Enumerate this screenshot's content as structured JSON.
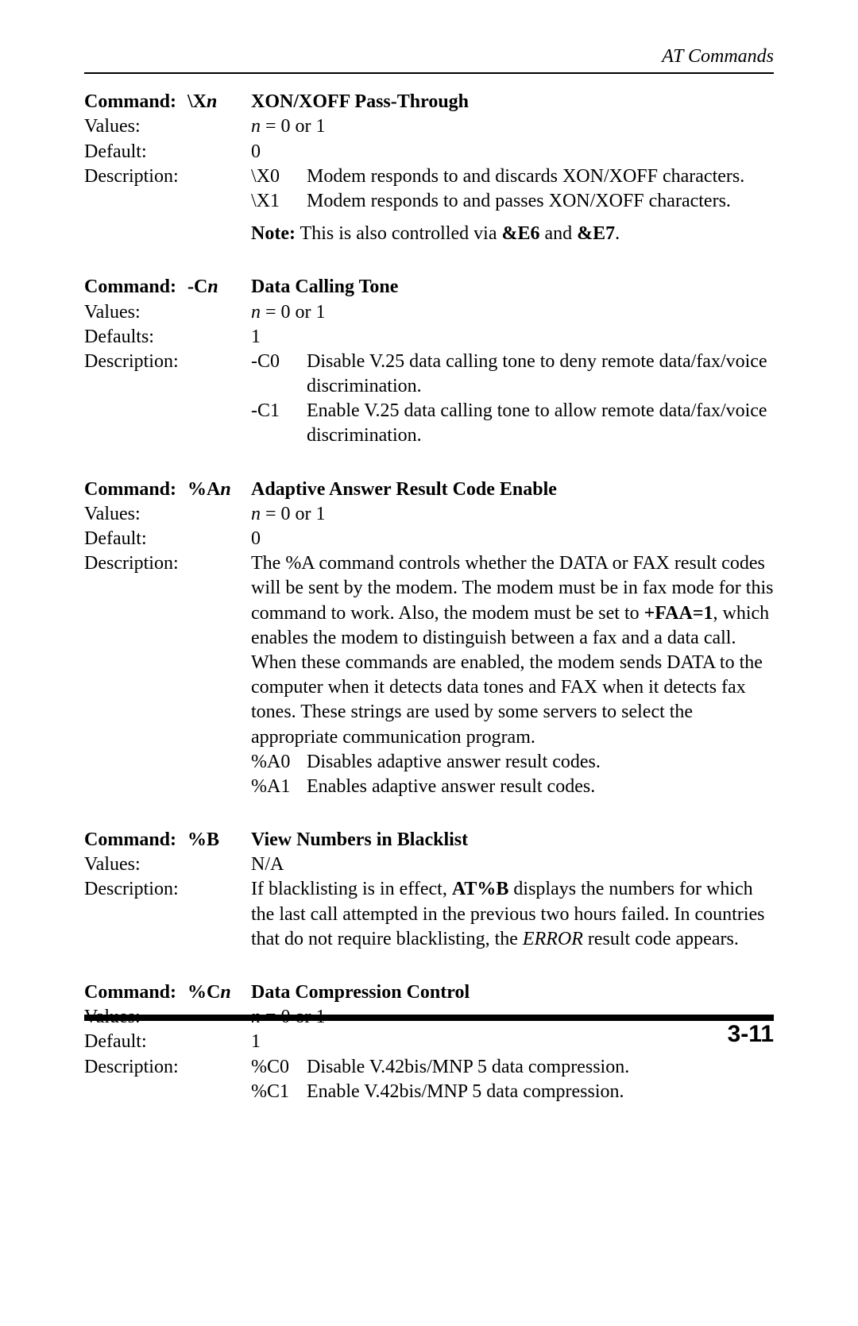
{
  "header": "AT Commands",
  "pageNumber": "3-11",
  "labels": {
    "command": "Command:",
    "values": "Values:",
    "default": "Default:",
    "defaults": "Defaults:",
    "description": "Description:",
    "note_prefix": "Note:",
    "note_rest": " This is also controlled via ",
    "note_and": " and ",
    "note_e6": "&E6",
    "note_e7": "&E7",
    "note_period": "."
  },
  "sections": [
    {
      "cmdPrefix": "\\X",
      "cmdVar": "n",
      "title": "XON/XOFF Pass-Through",
      "values_pre": "n",
      "values_post": " = 0 or 1",
      "defaultLabel": "default",
      "default": "0",
      "opts": [
        {
          "code": "\\X0",
          "text": "Modem responds to and discards XON/XOFF characters."
        },
        {
          "code": "\\X1",
          "text": "Modem responds to and passes XON/XOFF characters."
        }
      ],
      "hasNote": true
    },
    {
      "cmdPrefix": "-C",
      "cmdVar": "n",
      "title": "Data Calling Tone",
      "values_pre": "n",
      "values_post": " = 0 or 1",
      "defaultLabel": "defaults",
      "default": "1",
      "opts": [
        {
          "code": "-C0",
          "text": "Disable V.25 data calling tone to deny remote data/fax/voice discrimination."
        },
        {
          "code": "-C1",
          "text": "Enable V.25 data calling tone to allow remote data/fax/voice discrimination."
        }
      ]
    },
    {
      "cmdPrefix": "%A",
      "cmdVar": "n",
      "title": "Adaptive Answer Result Code Enable",
      "values_pre": "n",
      "values_post": " = 0 or 1",
      "defaultLabel": "default",
      "default": "0",
      "descPre": "The %A command controls whether the DATA or FAX result codes will be sent by the modem. The modem must be in fax mode for this command to work. Also, the modem must be set to ",
      "descBold": "+FAA=1",
      "descPost": ", which enables the modem to distinguish between a fax and a data call. When these commands are enabled, the modem sends DATA to the computer when it detects data tones and FAX when it detects fax tones. These strings are used by some servers to select the appropriate communication program.",
      "opts": [
        {
          "code": "%A0",
          "text": "Disables adaptive answer result codes."
        },
        {
          "code": "%A1",
          "text": "Enables adaptive answer result codes."
        }
      ]
    },
    {
      "cmdPrefix": "%B",
      "cmdVar": "",
      "title": "View Numbers in Blacklist",
      "values_literal": "N/A",
      "descB_pre": "If blacklisting is in effect, ",
      "descB_bold": "AT%B",
      "descB_mid": " displays the numbers for which the last call attempted in the previous two hours failed. In countries that do not require blacklisting, the ",
      "descB_italic": "ERROR",
      "descB_post": " result code appears."
    },
    {
      "cmdPrefix": "%C",
      "cmdVar": "n",
      "title": "Data Compression Control",
      "values_pre": "n",
      "values_post": " = 0 or 1",
      "defaultLabel": "default",
      "default": "1",
      "opts": [
        {
          "code": "%C0",
          "text": "Disable V.42bis/MNP 5 data compression."
        },
        {
          "code": "%C1",
          "text": "Enable V.42bis/MNP 5 data compression."
        }
      ]
    }
  ]
}
